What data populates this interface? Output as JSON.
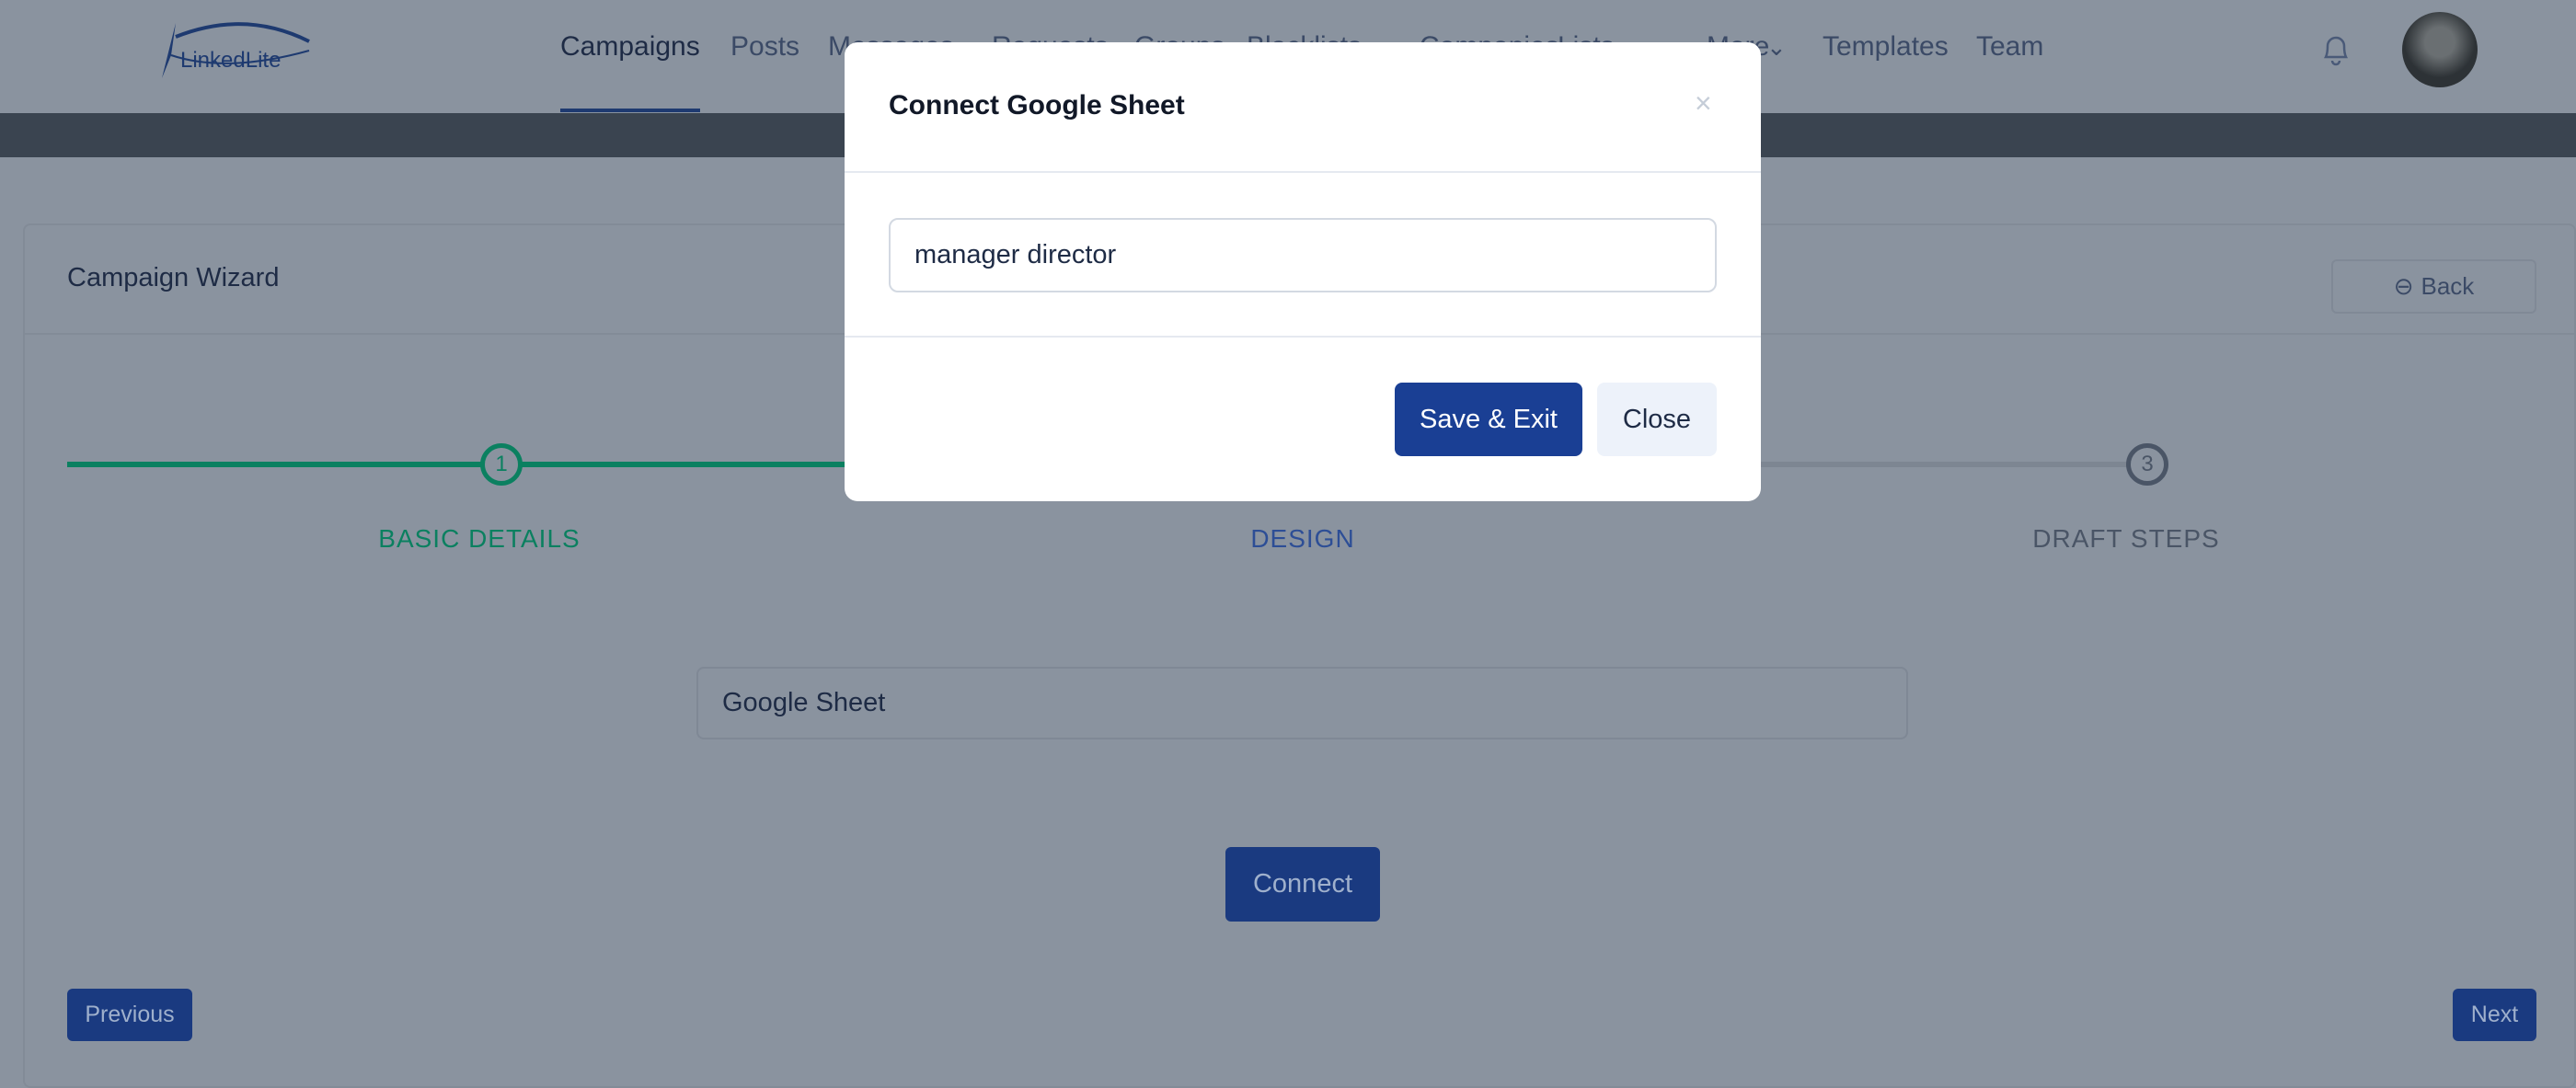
{
  "header": {
    "logo_text": "LinkedLite",
    "nav": [
      "Campaigns",
      "Posts",
      "Messages",
      "Requests",
      "Groups",
      "Blacklists",
      "Companies",
      "Lists",
      "More",
      "Templates",
      "Team"
    ],
    "active": "Campaigns"
  },
  "card": {
    "title": "Campaign Wizard",
    "back_label": "Back"
  },
  "steps": [
    {
      "num": "1",
      "label": "BASIC DETAILS",
      "state": "done"
    },
    {
      "num": "2",
      "label": "DESIGN",
      "state": "active"
    },
    {
      "num": "3",
      "label": "DRAFT STEPS",
      "state": "pending"
    }
  ],
  "form": {
    "source_value": "Google Sheet",
    "connect_label": "Connect"
  },
  "footer": {
    "previous_label": "Previous",
    "next_label": "Next"
  },
  "modal": {
    "title": "Connect Google Sheet",
    "input_value": "manager director",
    "save_label": "Save & Exit",
    "close_label": "Close"
  },
  "colors": {
    "primary": "#1a3a80",
    "success": "#0b8060",
    "overlay_bg": "#8a939f"
  }
}
